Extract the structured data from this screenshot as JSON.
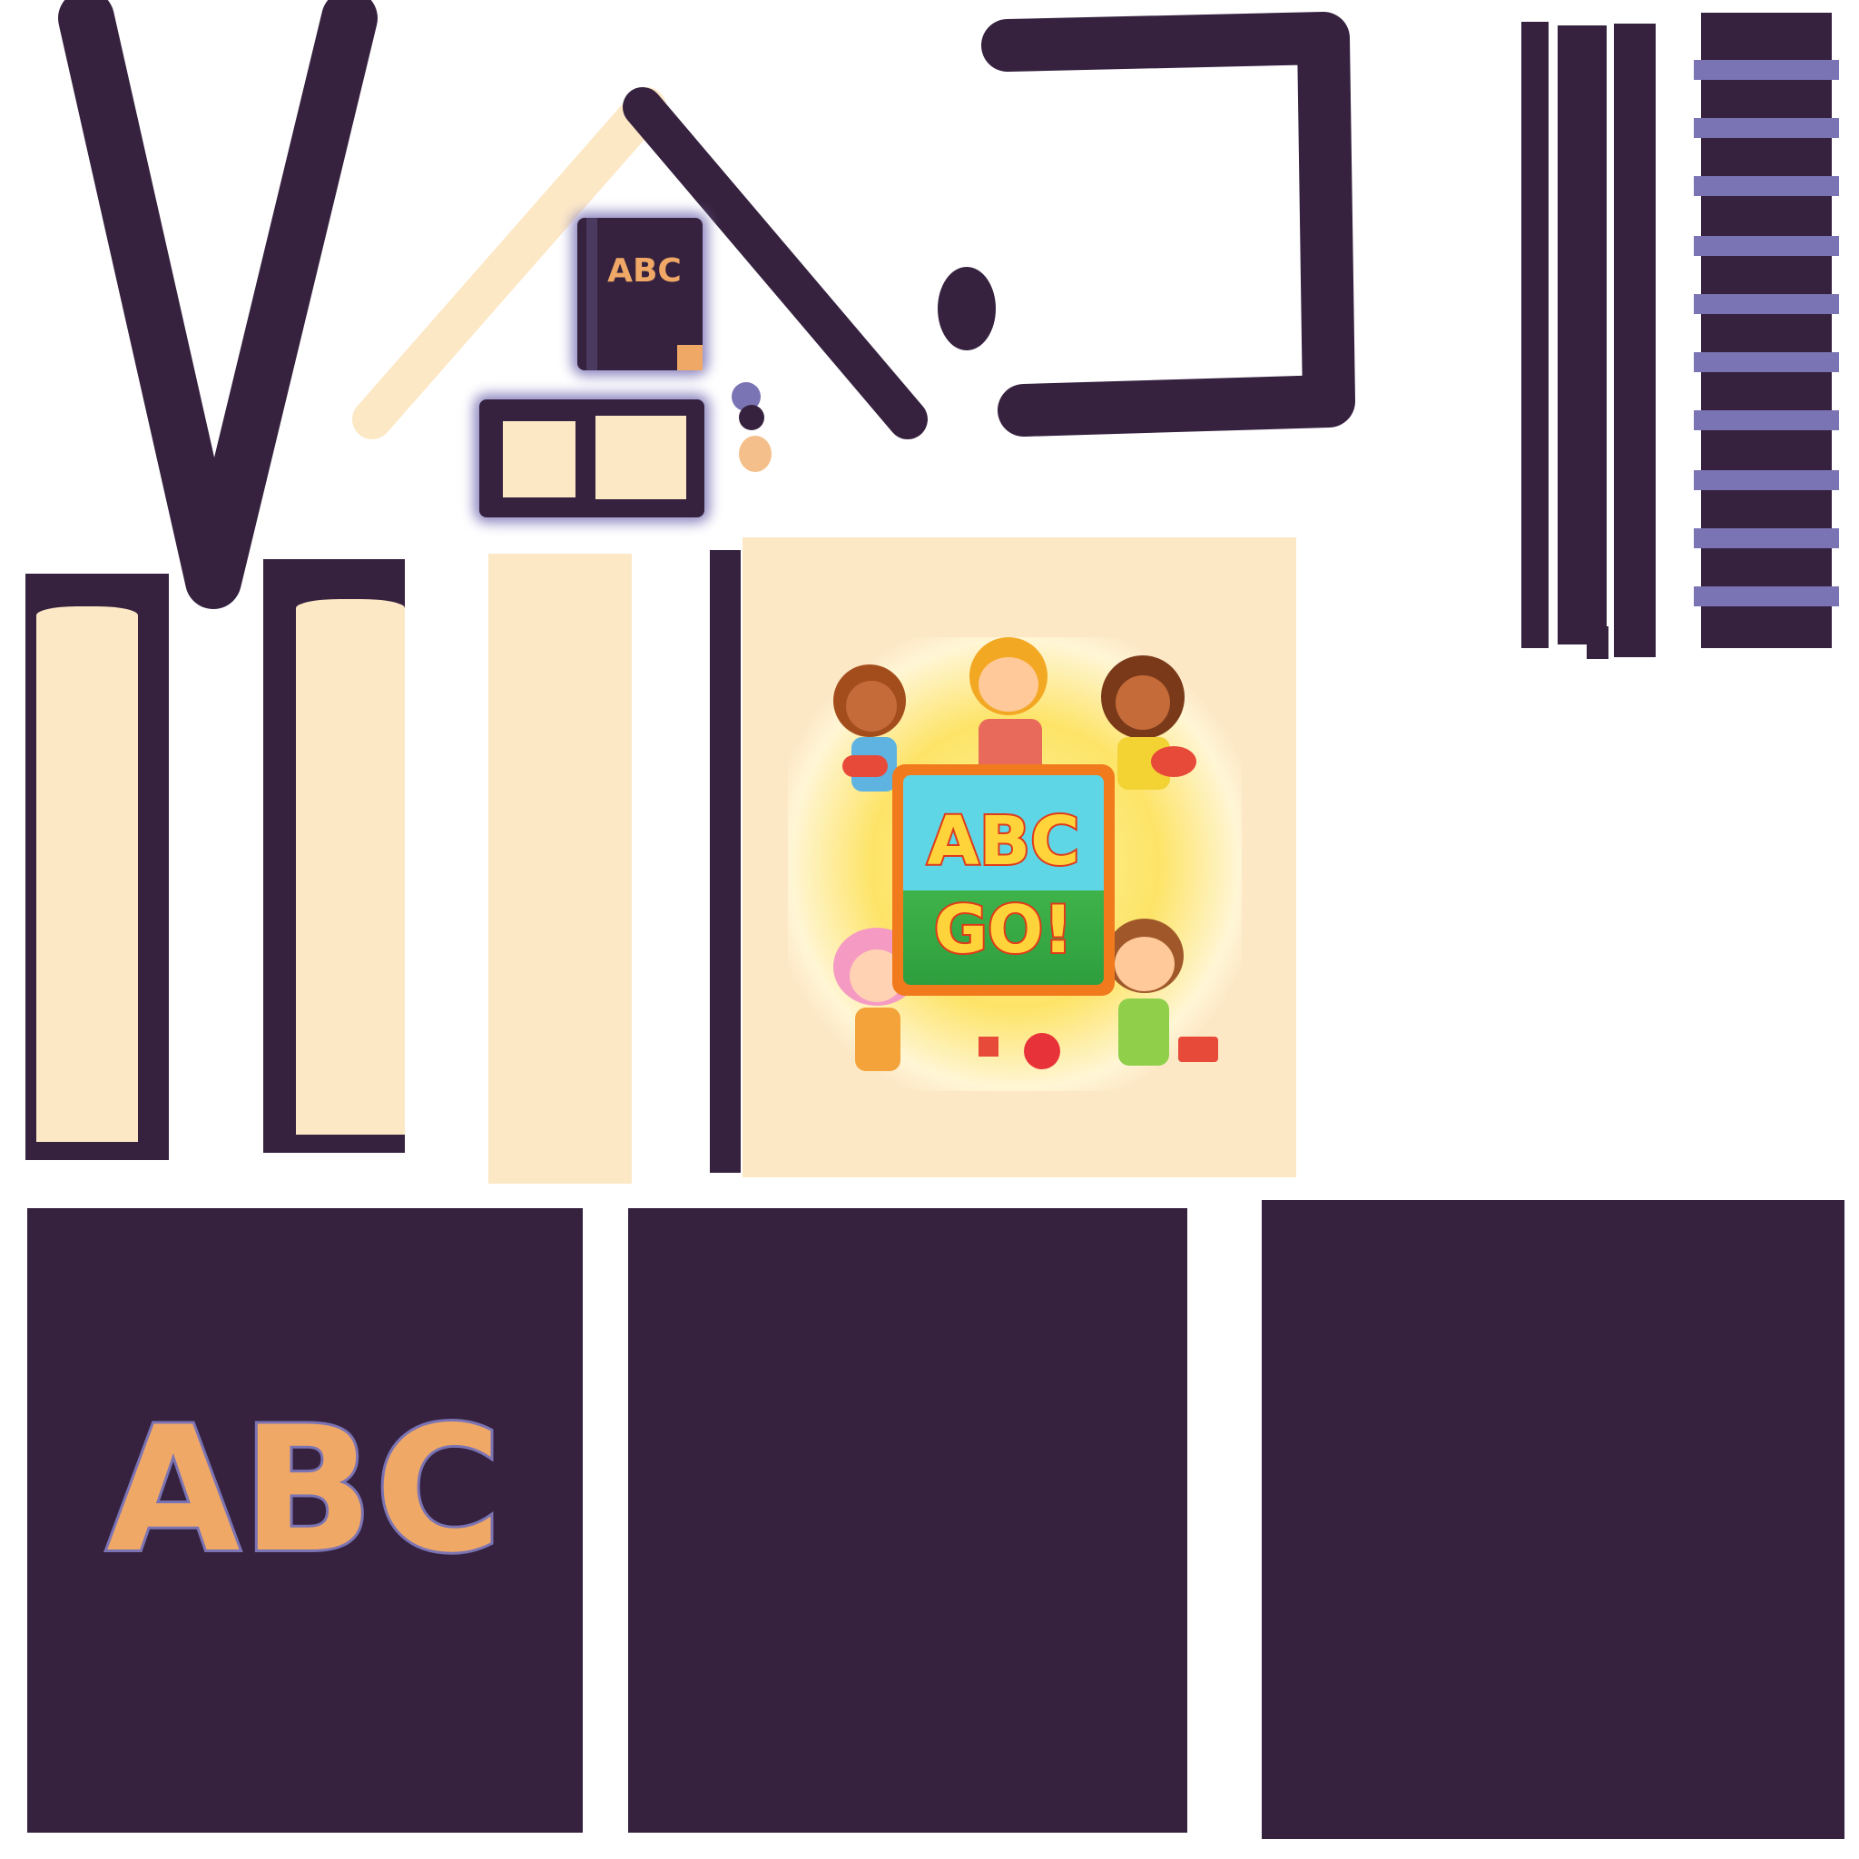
{
  "colors": {
    "dark_purple": "#36223f",
    "cream": "#fde8c6",
    "lavender": "#7b74b4",
    "orange": "#f0a866"
  },
  "book_icon": {
    "label": "ABC"
  },
  "abc_panel": {
    "text": "ABC"
  },
  "cover_art": {
    "title_line1": "ABC",
    "title_line2": "GO!"
  },
  "ladder": {
    "rungs": 10
  }
}
